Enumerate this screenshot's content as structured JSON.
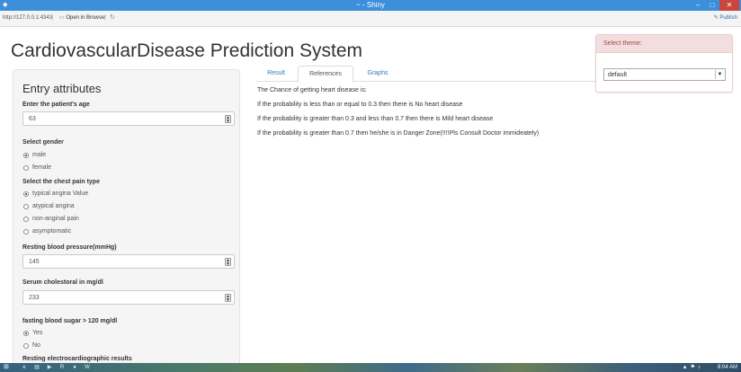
{
  "window": {
    "title": "~ - Shiny",
    "controls": {
      "minimize": "–",
      "maximize": "□",
      "close": "✕"
    }
  },
  "addressbar": {
    "url": "http://127.0.0.1:4343",
    "open_in_browser": "Open in Browser",
    "publish": "Publish"
  },
  "app": {
    "title": "CardiovascularDisease Prediction System"
  },
  "sidebar": {
    "heading": "Entry attributes",
    "age": {
      "label": "Enter the patient's age",
      "value": "63"
    },
    "gender": {
      "label": "Select gender",
      "options": [
        "male",
        "female"
      ],
      "selected": "male"
    },
    "chest_pain": {
      "label": "Select the chest pain type",
      "options": [
        "typical angina Value",
        "atypical angina",
        "non-anginal pain",
        "asymptomatic"
      ],
      "selected": "typical angina Value"
    },
    "blood_pressure": {
      "label": "Resting blood pressure(mmHg)",
      "value": "145"
    },
    "cholesterol": {
      "label": "Serum cholestoral in mg/dl",
      "value": "233"
    },
    "fasting_sugar": {
      "label": "fasting blood sugar > 120 mg/dl",
      "options": [
        "Yes",
        "No"
      ],
      "selected": "Yes"
    },
    "ecg": {
      "label": "Resting electrocardiographic results"
    }
  },
  "tabs": [
    {
      "label": "Result",
      "active": false
    },
    {
      "label": "References",
      "active": true
    },
    {
      "label": "Graphs",
      "active": false
    }
  ],
  "references": {
    "lines": [
      "The Chance of getting heart disease is:",
      "If the probability is less than or equal to 0.3 then there is No heart disease",
      "If the probability is greater than 0.3 and less than 0.7 then there is Mild heart disease",
      "If the probability is greater than 0.7 then he/she is in Danger Zone(!!!!Pls Consult Doctor immideately)"
    ]
  },
  "theme_selector": {
    "label": "Select theme:",
    "value": "default"
  },
  "taskbar": {
    "clock": "8:04 AM"
  },
  "colors": {
    "titlebar": "#3c8fd9",
    "close_button": "#c9463d",
    "link": "#337ab7",
    "theme_header_bg": "#f2dede",
    "theme_header_text": "#a94442"
  }
}
